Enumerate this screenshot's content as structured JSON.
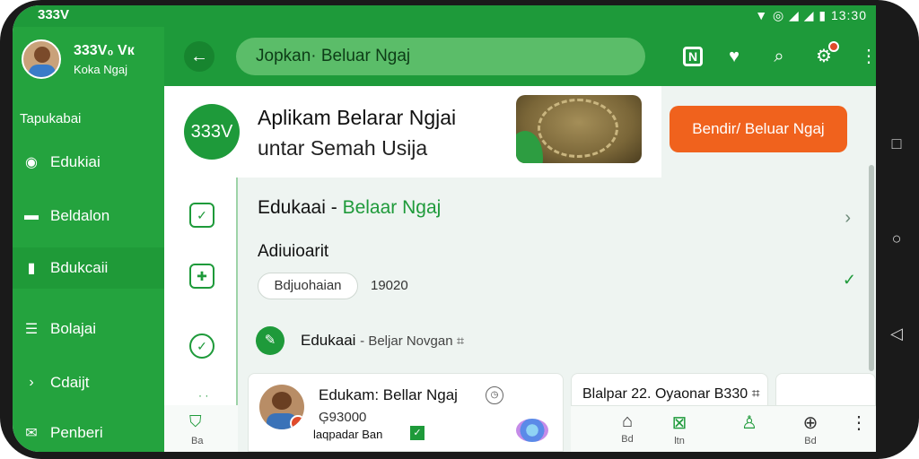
{
  "statusbar": {
    "time_left": "333V",
    "right": "▼ ◎ ◢ ◢ ▮ 13:30"
  },
  "sidebar": {
    "profile_name": "333V₀ Vк",
    "profile_sub": "Koka Ngaj",
    "section_title": "Tapukabai",
    "items": [
      {
        "label": "Edukiai",
        "icon": "◉"
      },
      {
        "label": "Beldalon",
        "icon": "▬"
      },
      {
        "label": "Bdukcaii",
        "icon": "▮"
      },
      {
        "label": "Bolajai",
        "icon": "☰"
      },
      {
        "label": "Cdaijt",
        "icon": "›"
      },
      {
        "label": "Penberi",
        "icon": "✉"
      }
    ]
  },
  "topbar": {
    "search_text": "Jopkan· Beluar Ngaj"
  },
  "banner": {
    "logo_text": "333V",
    "title": "Aplikam Belarar Ngjai",
    "subtitle": "untar Semah Usija",
    "cta_label": "Bendir/ Beluar Ngaj"
  },
  "content": {
    "title_prefix": "Edukaai - ",
    "title_green": "Belaar Ngaj",
    "subhead": "Adiuioarit",
    "chip_label": "Bdjuohaian",
    "number": "19020",
    "line3_main": "Edukaai",
    "line3_rest": "- Beljar Novgan ⌗"
  },
  "cards": [
    {
      "title": "Edukam: Bellar Ngaj",
      "number": "Ģ93000",
      "label": "laqpadar Ban"
    },
    {
      "title": "Blalpar 22. Oyaonar B330 ⌗"
    }
  ],
  "bottomnav": {
    "items": [
      "Bd",
      "ltn",
      "",
      "Bd",
      ""
    ]
  },
  "rail_bottom": {
    "label": "Ba"
  }
}
